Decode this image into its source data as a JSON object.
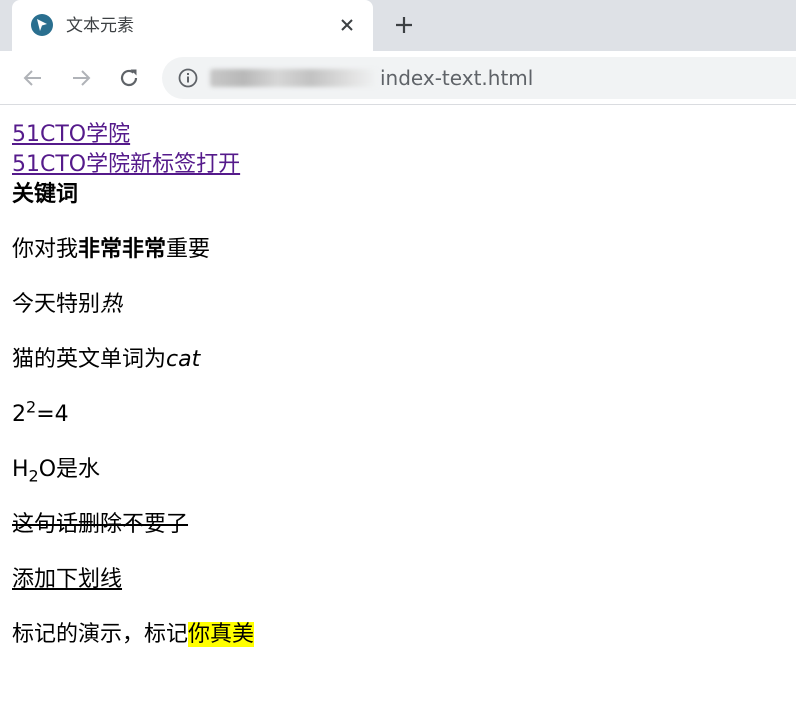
{
  "browser": {
    "tab_title": "文本元素",
    "url_suffix": "index-text.html"
  },
  "content": {
    "link1": "51CTO学院",
    "link2": "51CTO学院新标签打开",
    "keyword": "关键词",
    "strong": {
      "before": "你对我",
      "bold": "非常非常",
      "after": "重要"
    },
    "em1": {
      "before": "今天特别",
      "italic": "热"
    },
    "em2": {
      "before": "猫的英文单词为",
      "italic": "cat"
    },
    "sup": {
      "base": "2",
      "exp": "2",
      "after": "=4"
    },
    "sub": {
      "base": "H",
      "sub": "2",
      "after": "O是水"
    },
    "deleted": "这句话删除不要了",
    "underline": "添加下划线",
    "mark": {
      "before": "标记的演示，标记",
      "highlight": "你真美"
    }
  },
  "colors": {
    "link_visited": "#551a8b",
    "mark": "#ffff00",
    "favicon": "#2a6f8f"
  }
}
